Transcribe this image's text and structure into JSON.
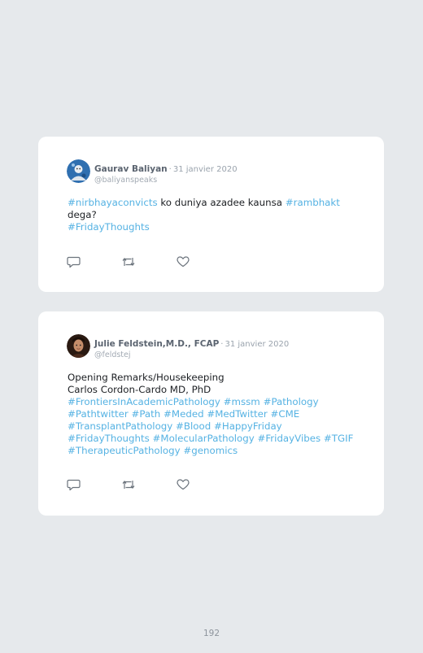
{
  "tweets": [
    {
      "author": "Gaurav Baliyan",
      "separator": "·",
      "date": "31 janvier 2020",
      "handle": "@baliyanspeaks",
      "body": {
        "line1_tag1": "#nirbhayaconvicts",
        "line1_text": " ko duniya azadee kaunsa ",
        "line1_tag2": "#rambhakt",
        "line2_text": "dega?",
        "line3_tag": "#FridayThoughts"
      }
    },
    {
      "author": "Julie Feldstein,M.D., FCAP",
      "separator": "·",
      "date": "31 janvier 2020",
      "handle": "@feldstej",
      "body": {
        "line1": "Opening Remarks/Housekeeping",
        "line2": "Carlos Cordon-Cardo MD, PhD",
        "tags_row3": [
          "#FrontiersInAcademicPathology",
          "#mssm",
          "#Pathology"
        ],
        "tags_row4": [
          "#Pathtwitter",
          "#Path",
          "#Meded",
          "#MedTwitter",
          "#CME"
        ],
        "tags_row5": [
          "#TransplantPathology",
          "#Blood",
          "#HappyFriday"
        ],
        "tags_row6": [
          "#FridayThoughts",
          "#MolecularPathology",
          "#FridayVibes",
          "#TGIF"
        ],
        "tags_row7": [
          "#TherapeuticPathology",
          "#genomics"
        ]
      }
    }
  ],
  "icons": {
    "reply": "reply-icon",
    "retweet": "retweet-icon",
    "like": "heart-icon"
  },
  "colors": {
    "hashtag": "#55b2e3",
    "background": "#e6e9ec",
    "card": "#ffffff"
  },
  "page_number": "192"
}
